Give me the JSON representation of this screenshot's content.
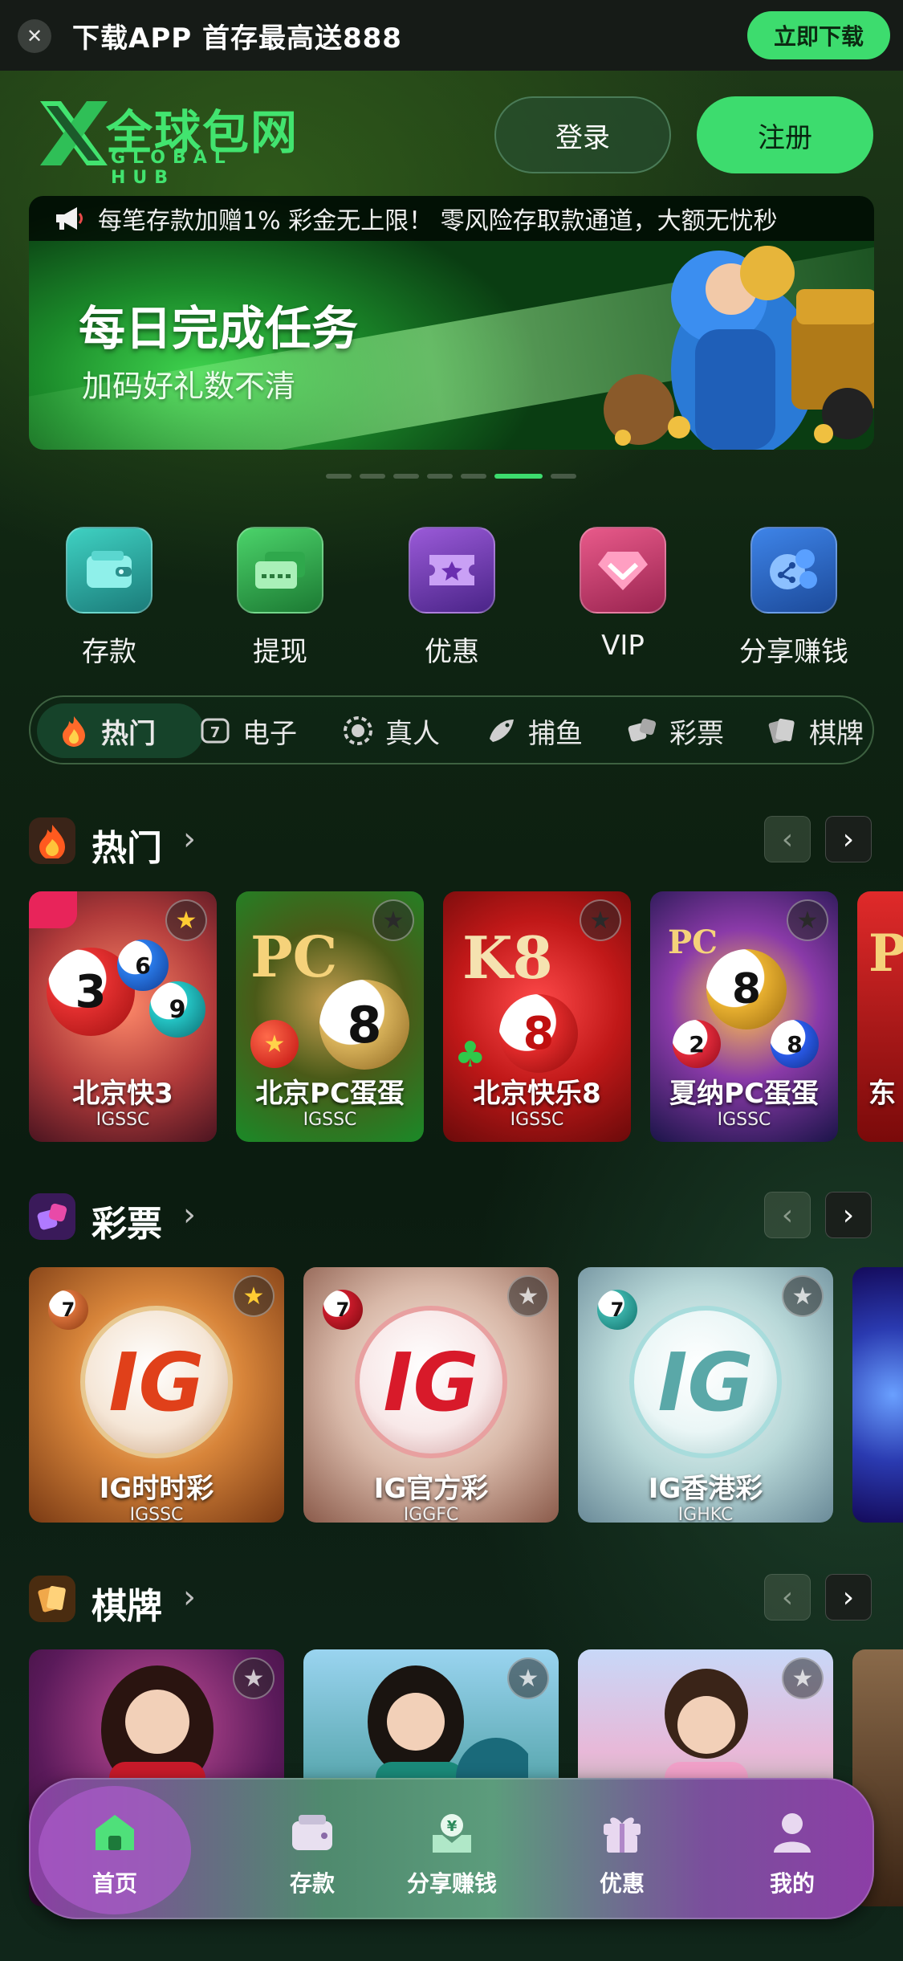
{
  "topbar": {
    "close": "✕",
    "text": "下载APP 首存最高送888",
    "download": "立即下载"
  },
  "header": {
    "logo_name": "全球包网",
    "logo_sub": "GLOBAL HUB",
    "login": "登录",
    "register": "注册"
  },
  "banner": {
    "ticker": "每笔存款加赠1% 彩金无上限！ 零风险存取款通道，大额无忧秒",
    "title": "每日完成任务",
    "subtitle": "加码好礼数不清"
  },
  "quick_actions": [
    {
      "label": "存款",
      "icon": "wallet-icon"
    },
    {
      "label": "提现",
      "icon": "card-icon"
    },
    {
      "label": "优惠",
      "icon": "ticket-icon"
    },
    {
      "label": "VIP",
      "icon": "diamond-icon"
    },
    {
      "label": "分享赚钱",
      "icon": "share-icon"
    }
  ],
  "tabs": [
    {
      "label": "热门",
      "icon": "fire-icon",
      "active": true
    },
    {
      "label": "电子",
      "icon": "slot-icon"
    },
    {
      "label": "真人",
      "icon": "chip-icon"
    },
    {
      "label": "捕鱼",
      "icon": "fish-icon"
    },
    {
      "label": "彩票",
      "icon": "dice-icon"
    },
    {
      "label": "棋牌",
      "icon": "cards-icon"
    }
  ],
  "hot": {
    "title": "热门",
    "cards": [
      {
        "name": "北京快3",
        "code": "IGSSC",
        "art": "BJK3"
      },
      {
        "name": "北京PC蛋蛋",
        "code": "IGSSC",
        "art": "PC"
      },
      {
        "name": "北京快乐8",
        "code": "IGSSC",
        "art": "K8"
      },
      {
        "name": "夏纳PC蛋蛋",
        "code": "IGSSC",
        "art": "PC"
      },
      {
        "name": "东",
        "art": "P"
      }
    ]
  },
  "lottery": {
    "title": "彩票",
    "cards": [
      {
        "name": "IG时时彩",
        "code": "IGSSC",
        "art": "IG"
      },
      {
        "name": "IG官方彩",
        "code": "IGGFC",
        "art": "IG"
      },
      {
        "name": "IG香港彩",
        "code": "IGHKC",
        "art": "IG"
      }
    ]
  },
  "chess": {
    "title": "棋牌"
  },
  "bottom_nav": [
    {
      "label": "首页",
      "icon": "home-icon",
      "active": true
    },
    {
      "label": "存款",
      "icon": "wallet-icon"
    },
    {
      "label": "分享赚钱",
      "icon": "share-money-icon"
    },
    {
      "label": "优惠",
      "icon": "gift-icon"
    },
    {
      "label": "我的",
      "icon": "user-icon"
    }
  ],
  "colors": {
    "accent": "#3ddc6e",
    "background": "#0f2412"
  }
}
